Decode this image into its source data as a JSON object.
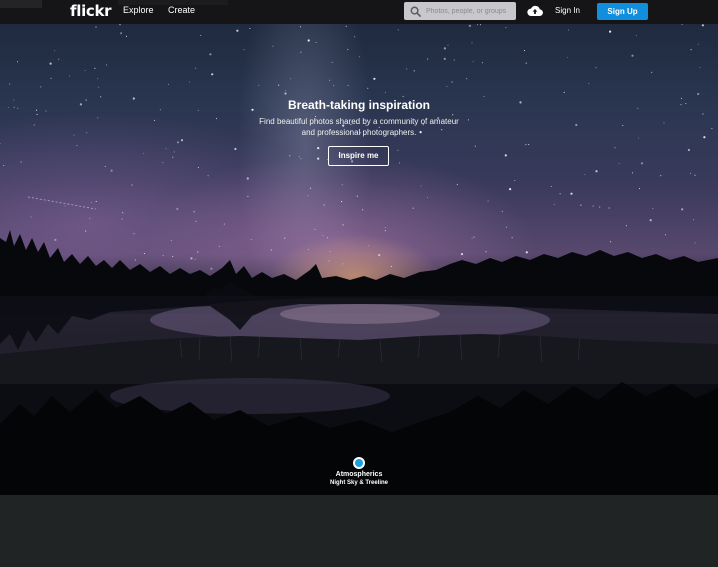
{
  "header": {
    "logo": "flickr",
    "nav": [
      {
        "label": "Explore"
      },
      {
        "label": "Create"
      }
    ],
    "search": {
      "placeholder": "Photos, people, or groups",
      "value": "",
      "icon": "search-icon"
    },
    "upload_icon": "cloud-upload-icon",
    "signin_label": "Sign In",
    "signup_label": "Sign Up",
    "signup_color": "#128fdc"
  },
  "hero": {
    "title": "Breath-taking inspiration",
    "subtitle_line1": "Find beautiful photos shared by a community of amateur",
    "subtitle_line2": "and professional photographers.",
    "cta_label": "Inspire me",
    "photo_title": "Atmospherics",
    "photo_subtitle": "Night Sky & Treeline",
    "attribution_dot_color": "#19a0de"
  }
}
